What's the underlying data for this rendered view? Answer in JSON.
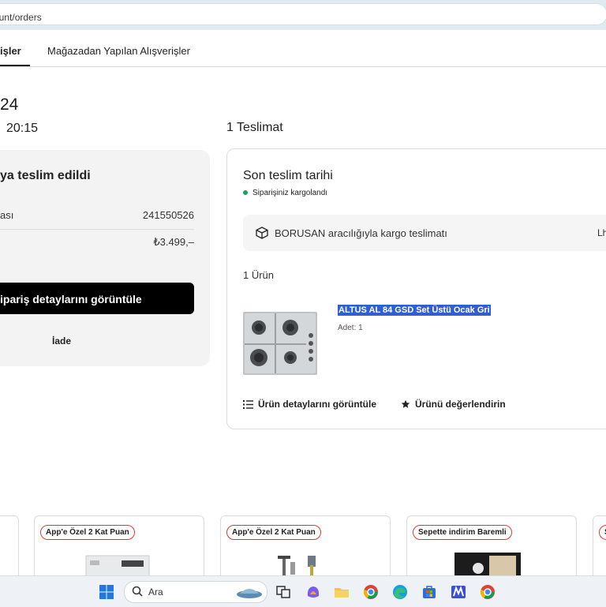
{
  "browser": {
    "url_visible": "ccount/orders"
  },
  "tabs": [
    {
      "label": "işler",
      "active": true
    },
    {
      "label": "Mağazadan Yapılan Alışverişler",
      "active": false
    }
  ],
  "order": {
    "date_partial": "24",
    "time": "20:15"
  },
  "summary": {
    "title": "ya teslim edildi",
    "rows": [
      {
        "label": "ası",
        "value": "241550526"
      },
      {
        "label": "",
        "value": "₺3.499,–"
      }
    ],
    "details_button": "ipariş detaylarını görüntüle",
    "return_link": "İade"
  },
  "delivery": {
    "count_label": "1 Teslimat",
    "title": "Son teslim tarihi",
    "status": "Siparişiniz kargolandı",
    "status_color": "#21a05b",
    "cargo_text": "BORUSAN aracılığıyla kargo teslimatı",
    "cargo_right": "Lh",
    "product_count": "1 Ürün",
    "product": {
      "name": "ALTUS AL 84 GSD Set Üstü Ocak Gri",
      "qty": "Adet: 1"
    },
    "actions": {
      "details": "Ürün detaylarını görüntüle",
      "rate": "Ürünü değerlendirin"
    }
  },
  "recommendations": [
    {
      "badge": "App'e Özel 2 Kat Puan"
    },
    {
      "badge": "App'e Özel 2 Kat Puan"
    },
    {
      "badge": "Sepette indirim Baremli"
    },
    {
      "badge": "S"
    }
  ],
  "taskbar": {
    "search_placeholder": "Ara"
  },
  "colors": {
    "accent_badge_border": "#e0392a",
    "primary_button": "#000000",
    "selection": "#2f5fd0"
  }
}
